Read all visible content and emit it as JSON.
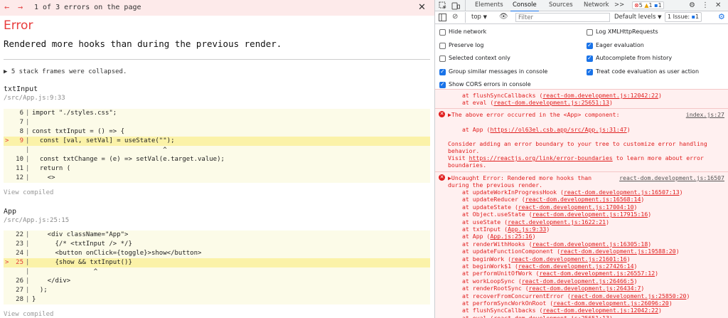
{
  "overlay": {
    "prev_icon": "←",
    "next_icon": "→",
    "error_count": "1 of 3 errors on the page",
    "close_icon": "✕",
    "title": "Error",
    "message": "Rendered more hooks than during the previous render.",
    "collapsed": "▶ 5 stack frames were collapsed.",
    "frames": [
      {
        "name": "txtInput",
        "path": "/src/App.js:9:33",
        "lines": [
          {
            "marker": "",
            "num": "6",
            "text": "import \"./styles.css\";",
            "hl": false
          },
          {
            "marker": "",
            "num": "7",
            "text": "",
            "hl": false
          },
          {
            "marker": "",
            "num": "8",
            "text": "const txtInput = () => {",
            "hl": false
          },
          {
            "marker": ">",
            "num": "9",
            "text": "  const [val, setVal] = useState(\"\");",
            "hl": true
          },
          {
            "marker": "",
            "num": "",
            "text": "                                  ^",
            "hl": false
          },
          {
            "marker": "",
            "num": "10",
            "text": "  const txtChange = (e) => setVal(e.target.value);",
            "hl": false
          },
          {
            "marker": "",
            "num": "11",
            "text": "  return (",
            "hl": false
          },
          {
            "marker": "",
            "num": "12",
            "text": "    <>",
            "hl": false
          }
        ],
        "view_compiled": "View compiled"
      },
      {
        "name": "App",
        "path": "/src/App.js:25:15",
        "lines": [
          {
            "marker": "",
            "num": "22",
            "text": "    <div className=\"App\">",
            "hl": false
          },
          {
            "marker": "",
            "num": "23",
            "text": "      {/* <txtInput /> */}",
            "hl": false
          },
          {
            "marker": "",
            "num": "24",
            "text": "      <button onClick={toggle}>show</button>",
            "hl": false
          },
          {
            "marker": ">",
            "num": "25",
            "text": "      {show && txtInput()}",
            "hl": true
          },
          {
            "marker": "",
            "num": "",
            "text": "                ^",
            "hl": false
          },
          {
            "marker": "",
            "num": "26",
            "text": "    </div>",
            "hl": false
          },
          {
            "marker": "",
            "num": "27",
            "text": "  );",
            "hl": false
          },
          {
            "marker": "",
            "num": "28",
            "text": "}",
            "hl": false
          }
        ],
        "view_compiled": "View compiled"
      }
    ]
  },
  "devtools": {
    "tabs": [
      "Elements",
      "Console",
      "Sources",
      "Network"
    ],
    "active_tab": "Console",
    "more_tabs": ">>",
    "error_badge": "5",
    "warning_badge": "1",
    "message_badge": "1",
    "toolbar": {
      "context": "top",
      "filter_placeholder": "Filter",
      "levels": "Default levels",
      "issues": "1 Issue:",
      "issues_count": "1"
    },
    "settings_left": [
      {
        "label": "Hide network",
        "checked": false
      },
      {
        "label": "Preserve log",
        "checked": false
      },
      {
        "label": "Selected context only",
        "checked": false
      },
      {
        "label": "Group similar messages in console",
        "checked": true
      },
      {
        "label": "Show CORS errors in console",
        "checked": true
      }
    ],
    "settings_right": [
      {
        "label": "Log XMLHttpRequests",
        "checked": false
      },
      {
        "label": "Eager evaluation",
        "checked": true
      },
      {
        "label": "Autocomplete from history",
        "checked": true
      },
      {
        "label": "Treat code evaluation as user action",
        "checked": true
      }
    ],
    "console": {
      "top_lines": [
        {
          "prefix": "at flushSyncCallbacks (",
          "link": "react-dom.development.js:12042:22",
          "suffix": ")"
        },
        {
          "prefix": "at eval (",
          "link": "react-dom.development.js:25651:13",
          "suffix": ")"
        }
      ],
      "msg1": {
        "head": "▶The above error occurred in the <App> component:",
        "source": "index.js:27",
        "at_prefix": "at App (",
        "at_link": "https://ol63el.csb.app/src/App.js:31:47",
        "at_suffix": ")",
        "advice1": "Consider adding an error boundary to your tree to customize error handling",
        "advice2": "behavior.",
        "visit_prefix": "Visit ",
        "visit_link": "https://reactjs.org/link/error-boundaries",
        "visit_suffix": " to learn more about error",
        "advice3": "boundaries."
      },
      "msg2": {
        "head": "▶Uncaught Error: Rendered more hooks than",
        "source": "react-dom.development.js:16507",
        "head2": "during the previous render.",
        "stack": [
          {
            "prefix": "at updateWorkInProgressHook (",
            "link": "react-dom.development.js:16507:13",
            "suffix": ")"
          },
          {
            "prefix": "at updateReducer (",
            "link": "react-dom.development.js:16568:14",
            "suffix": ")"
          },
          {
            "prefix": "at updateState (",
            "link": "react-dom.development.js:17004:10",
            "suffix": ")"
          },
          {
            "prefix": "at Object.useState (",
            "link": "react-dom.development.js:17915:16",
            "suffix": ")"
          },
          {
            "prefix": "at useState (",
            "link": "react.development.js:1622:21",
            "suffix": ")"
          },
          {
            "prefix": "at txtInput (",
            "link": "App.js:9:33",
            "suffix": ")"
          },
          {
            "prefix": "at App (",
            "link": "App.js:25:16",
            "suffix": ")"
          },
          {
            "prefix": "at renderWithHooks (",
            "link": "react-dom.development.js:16305:18",
            "suffix": ")"
          },
          {
            "prefix": "at updateFunctionComponent (",
            "link": "react-dom.development.js:19588:20",
            "suffix": ")"
          },
          {
            "prefix": "at beginWork (",
            "link": "react-dom.development.js:21601:16",
            "suffix": ")"
          },
          {
            "prefix": "at beginWork$1 (",
            "link": "react-dom.development.js:27426:14",
            "suffix": ")"
          },
          {
            "prefix": "at performUnitOfWork (",
            "link": "react-dom.development.js:26557:12",
            "suffix": ")"
          },
          {
            "prefix": "at workLoopSync (",
            "link": "react-dom.development.js:26466:5",
            "suffix": ")"
          },
          {
            "prefix": "at renderRootSync (",
            "link": "react-dom.development.js:26434:7",
            "suffix": ")"
          },
          {
            "prefix": "at recoverFromConcurrentError (",
            "link": "react-dom.development.js:25850:20",
            "suffix": ")"
          },
          {
            "prefix": "at performSyncWorkOnRoot (",
            "link": "react-dom.development.js:26096:20",
            "suffix": ")"
          },
          {
            "prefix": "at flushSyncCallbacks (",
            "link": "react-dom.development.js:12042:22",
            "suffix": ")"
          },
          {
            "prefix": "at eval (",
            "link": "react-dom.development.js:25651:13",
            "suffix": ")"
          }
        ]
      }
    }
  }
}
